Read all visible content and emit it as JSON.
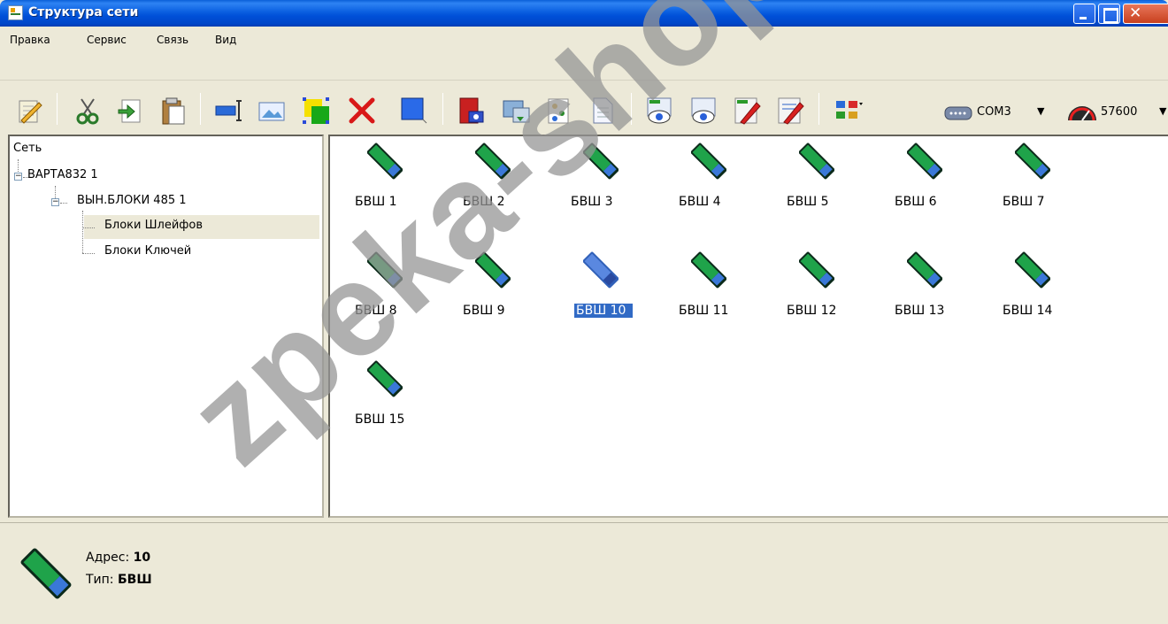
{
  "window": {
    "title": "Структура сети"
  },
  "menu": {
    "items": [
      "Правка",
      "Сервис",
      "Связь",
      "Вид"
    ]
  },
  "toolbar": {
    "icons": [
      "edit-icon",
      "cut-icon",
      "paste-into-icon",
      "paste-icon",
      "rename-icon",
      "image-icon",
      "select-area-icon",
      "delete-icon",
      "blue-square-icon",
      "book-icon",
      "monitor-icon",
      "tree-icon",
      "document-icon",
      "view-icon",
      "view-alt-icon",
      "write-icon",
      "write-red-icon",
      "layout-icon"
    ],
    "port": "COM3",
    "speed": "57600"
  },
  "tree": {
    "root": "Сеть",
    "device": "ВАРТА832 1",
    "module": "ВЫН.БЛОКИ 485 1",
    "leaf1": "Блоки Шлейфов",
    "leaf2": "Блоки Ключей"
  },
  "devices": [
    {
      "label": "БВШ 1"
    },
    {
      "label": "БВШ 2"
    },
    {
      "label": "БВШ 3"
    },
    {
      "label": "БВШ 4"
    },
    {
      "label": "БВШ 5"
    },
    {
      "label": "БВШ 6"
    },
    {
      "label": "БВШ 7"
    },
    {
      "label": "БВШ 8"
    },
    {
      "label": "БВШ 9"
    },
    {
      "label": "БВШ 10"
    },
    {
      "label": "БВШ 11"
    },
    {
      "label": "БВШ 12"
    },
    {
      "label": "БВШ 13"
    },
    {
      "label": "БВШ 14"
    },
    {
      "label": "БВШ 15"
    }
  ],
  "selected_device": "БВШ 10",
  "status": {
    "address_label": "Адрес:",
    "address_value": "10",
    "type_label": "Тип:",
    "type_value": "БВШ"
  },
  "watermark": "zpeka-shop.com",
  "colors": {
    "titlebar": "#0a5fe0",
    "selection": "#316ac5",
    "device_green": "#1fa34a",
    "device_dark": "#0b2a1a"
  }
}
